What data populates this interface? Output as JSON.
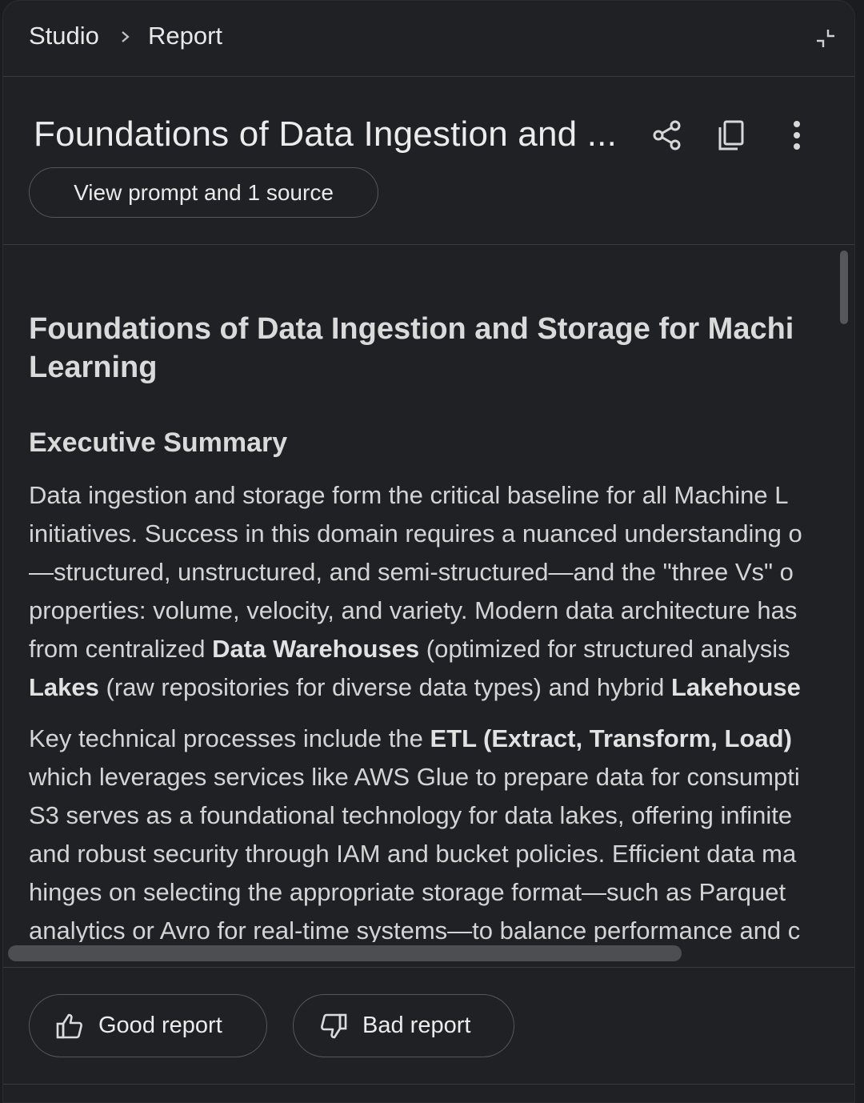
{
  "breadcrumb": {
    "items": [
      "Studio",
      "Report"
    ]
  },
  "header": {
    "title": "Foundations of Data Ingestion and ...",
    "view_prompt_label": "View prompt and 1 source"
  },
  "article": {
    "title_lines": [
      "Foundations of Data Ingestion and Storage for Machi",
      "Learning"
    ],
    "section_heading": "Executive Summary",
    "para1": [
      "Data ingestion and storage form the critical baseline for all Machine L",
      "initiatives. Success in this domain requires a nuanced understanding o",
      "—structured, unstructured, and semi-structured—and the \"three Vs\" o",
      "properties: volume, velocity, and variety. Modern data architecture has"
    ],
    "para1_line5": {
      "pre": "from centralized ",
      "bold": "Data Warehouses",
      "post": " (optimized for structured analysis"
    },
    "para1_line6": {
      "bold1": "Lakes",
      "mid": " (raw repositories for diverse data types) and hybrid ",
      "bold2": "Lakehouse"
    },
    "para2_line1": {
      "pre": "Key technical processes include the ",
      "bold": "ETL (Extract, Transform, Load)"
    },
    "para2": [
      "which leverages services like AWS Glue to prepare data for consumpti",
      "S3 serves as a foundational technology for data lakes, offering infinite",
      "and robust security through IAM and bucket policies. Efficient data ma",
      "hinges on selecting the appropriate storage format—such as Parquet",
      "analytics or Avro for real-time systems—to balance performance and c"
    ]
  },
  "feedback": {
    "good_label": "Good report",
    "bad_label": "Bad report"
  }
}
